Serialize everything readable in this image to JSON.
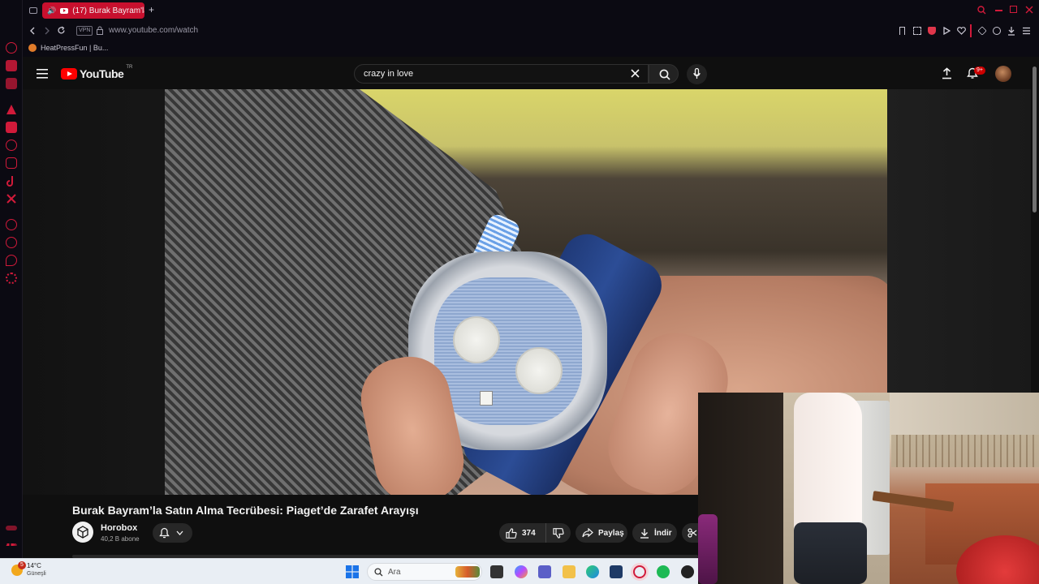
{
  "browser": {
    "tab_title": "(17) Burak Bayram'la S",
    "new_tab": "+",
    "url": "www.youtube.com/watch",
    "vpn": "VPN",
    "bookmark": "HeatPressFun | Bu..."
  },
  "youtube": {
    "logo_text": "YouTube",
    "region": "TR",
    "search_value": "crazy in love",
    "notification_count": "9+"
  },
  "video": {
    "title": "Burak Bayram’la Satın Alma Tecrübesi: Piaget’de Zarafet Arayışı",
    "channel_name": "Horobox",
    "subscribers": "40,2 B abone",
    "likes": "374",
    "share_label": "Paylaş",
    "download_label": "İndir"
  },
  "taskbar": {
    "temperature": "14°C",
    "weather_text": "Güneşli",
    "weather_badge": "5",
    "search_placeholder": "Ara"
  },
  "colors": {
    "youtube_red": "#ff0000",
    "opera_red": "#c8102e",
    "background": "#0f0f0f"
  }
}
